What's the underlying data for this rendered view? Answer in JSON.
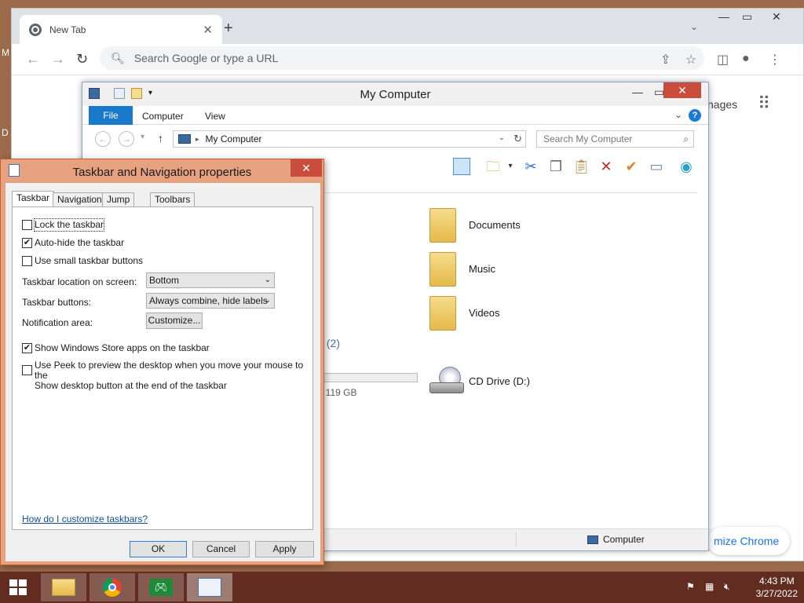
{
  "desktop": {
    "edge_letters": [
      "M",
      "D"
    ]
  },
  "chrome": {
    "tab_title": "New Tab",
    "omnibox_placeholder": "Search Google or type a URL",
    "ntp_images_partial": "nages",
    "ntp_customize_partial": "mize Chrome",
    "icons": [
      "favicon-icon",
      "tab-close-icon",
      "new-tab-icon",
      "tab-search-icon",
      "minimize-icon",
      "maximize-icon",
      "close-icon",
      "back-icon",
      "forward-icon",
      "reload-icon",
      "search-icon",
      "share-icon",
      "bookmark-star-icon",
      "side-panel-icon",
      "profile-icon",
      "menu-icon",
      "apps-grid-icon"
    ]
  },
  "explorer": {
    "title": "My Computer",
    "ribbon": {
      "file": "File",
      "tabs": [
        "Computer",
        "View"
      ]
    },
    "address": "My Computer",
    "search_placeholder": "Search My Computer",
    "folders": [
      {
        "name": "Documents",
        "icon": "documents-folder-icon"
      },
      {
        "name": "Music",
        "icon": "music-folder-icon"
      },
      {
        "name": "Videos",
        "icon": "videos-folder-icon"
      }
    ],
    "section_partial": "s (2)",
    "disk_label_partial": ")",
    "disk_free_partial": "f 119 GB",
    "cd_drive": "CD Drive (D:)",
    "status_text": "Computer",
    "toolbar_icons": [
      "preview-pane-icon",
      "folder-options-icon",
      "cut-icon",
      "copy-icon",
      "paste-icon",
      "delete-icon",
      "check-icon",
      "rename-icon",
      "network-icon"
    ]
  },
  "props_dialog": {
    "title": "Taskbar and Navigation properties",
    "tabs": [
      "Taskbar",
      "Navigation",
      "Jump Lists",
      "Toolbars"
    ],
    "selected_tab": "Taskbar",
    "lock_taskbar": {
      "label": "Lock the taskbar",
      "checked": false
    },
    "auto_hide": {
      "label": "Auto-hide the taskbar",
      "checked": true
    },
    "small_buttons": {
      "label": "Use small taskbar buttons",
      "checked": false
    },
    "location": {
      "label": "Taskbar location on screen:",
      "value": "Bottom"
    },
    "buttons": {
      "label": "Taskbar buttons:",
      "value": "Always combine, hide labels"
    },
    "notification": {
      "label": "Notification area:",
      "button": "Customize..."
    },
    "store_apps": {
      "label": "Show Windows Store apps on the taskbar",
      "checked": true
    },
    "peek": {
      "label_line1": "Use Peek to preview the desktop when you move your mouse to the",
      "label_line2": "Show desktop button at the end of the taskbar",
      "checked": false
    },
    "help_link": "How do I customize taskbars?",
    "ok": "OK",
    "cancel": "Cancel",
    "apply": "Apply"
  },
  "taskbar": {
    "apps": [
      {
        "name": "file-explorer",
        "icon": "file-explorer-icon",
        "state": "open"
      },
      {
        "name": "chrome",
        "icon": "chrome-icon",
        "state": "open"
      },
      {
        "name": "xbox",
        "icon": "xbox-icon",
        "state": "open"
      },
      {
        "name": "taskbar-properties",
        "icon": "taskbar-properties-icon",
        "state": "active"
      }
    ],
    "tray_icons": [
      "action-center-flag-icon",
      "network-icon",
      "volume-muted-icon"
    ],
    "time": "4:43 PM",
    "date": "3/27/2022"
  }
}
